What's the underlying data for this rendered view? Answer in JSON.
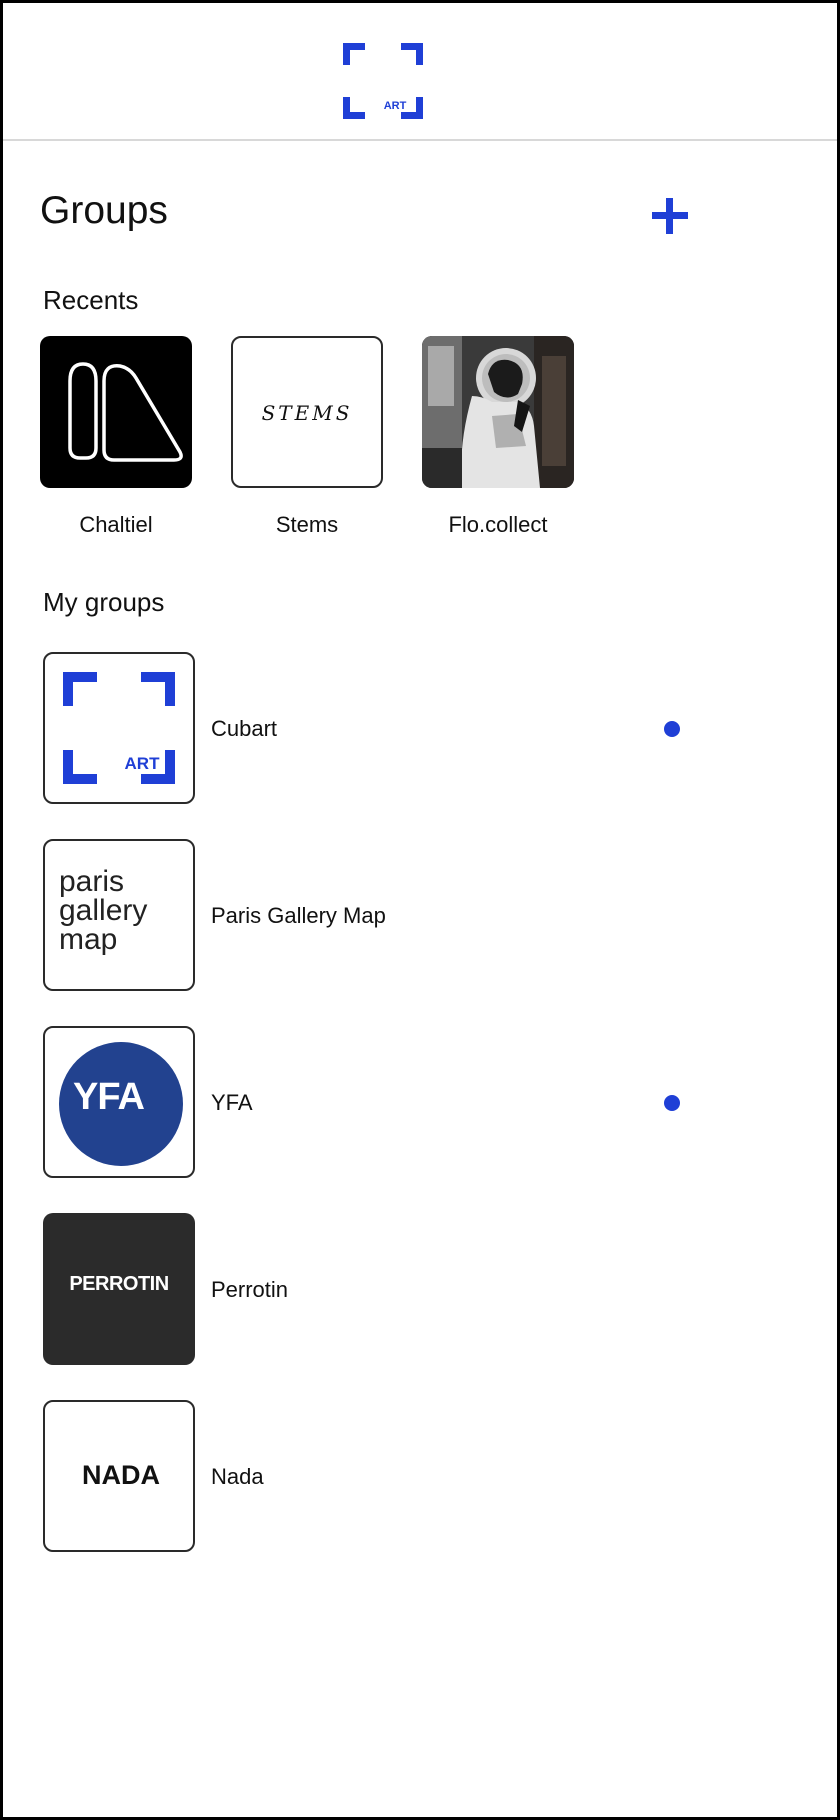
{
  "header": {
    "logo_text": "ART",
    "accent_color": "#1f3fd6"
  },
  "page": {
    "title": "Groups",
    "add_icon": "plus-icon"
  },
  "recents": {
    "label": "Recents",
    "items": [
      {
        "name": "Chaltiel"
      },
      {
        "name": "Stems",
        "logo_text": "STEMS"
      },
      {
        "name": "Flo.collect"
      }
    ]
  },
  "my_groups": {
    "label": "My groups",
    "items": [
      {
        "name": "Cubart",
        "logo_text": "ART",
        "unread": true
      },
      {
        "name": "Paris Gallery Map",
        "logo_text": "paris\ngallery\nmap",
        "unread": false
      },
      {
        "name": "YFA",
        "logo_text": "YFA",
        "unread": true
      },
      {
        "name": "Perrotin",
        "logo_text": "PERROTIN",
        "unread": false
      },
      {
        "name": "Nada",
        "logo_text": "NADA",
        "unread": false
      }
    ]
  }
}
